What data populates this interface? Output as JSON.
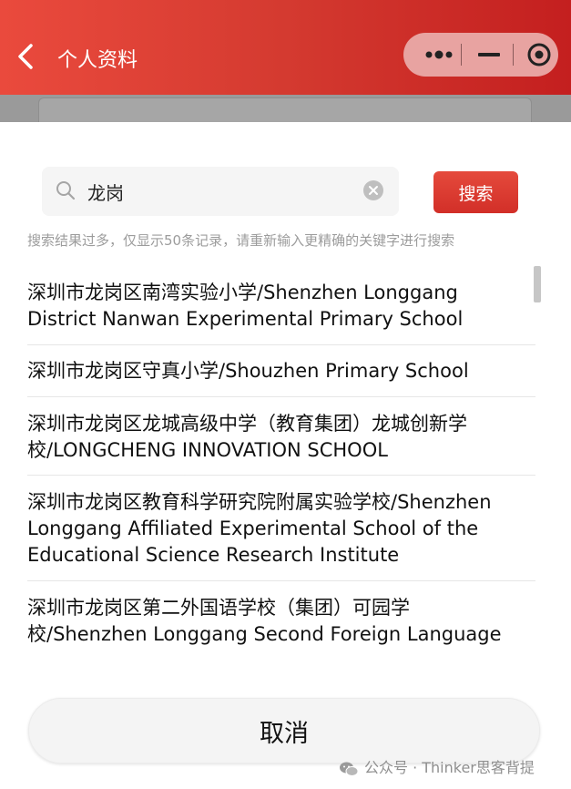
{
  "header": {
    "title": "个人资料"
  },
  "capsule": {
    "more_icon": "ellipsis-icon",
    "minimize_icon": "minus-icon",
    "close_icon": "target-icon"
  },
  "search": {
    "value": "龙岗",
    "button_label": "搜索"
  },
  "hint": "搜索结果过多，仅显示50条记录，请重新输入更精确的关键字进行搜索",
  "results": [
    {
      "lines": [
        "深圳市龙岗区南湾实验小学/Shenzhen Longgang",
        "District Nanwan Experimental Primary School"
      ]
    },
    {
      "lines": [
        "深圳市龙岗区守真小学/Shouzhen Primary School"
      ]
    },
    {
      "lines": [
        "深圳市龙岗区龙城高级中学（教育集团）龙城创新学",
        "校/LONGCHENG INNOVATION SCHOOL"
      ]
    },
    {
      "lines": [
        "深圳市龙岗区教育科学研究院附属实验学校/Shenzhen",
        "Longgang Affiliated Experimental School of the",
        "Educational Science Research Institute"
      ]
    },
    {
      "lines": [
        "深圳市龙岗区第二外国语学校（集团）可园学",
        "校/Shenzhen Longgang Second Foreign Language"
      ]
    }
  ],
  "cancel_label": "取消",
  "watermark": "公众号 · Thinker思客背提",
  "colors": {
    "accent": "#d83a30",
    "header_start": "#ea4a3d",
    "header_end": "#c41f1f"
  }
}
